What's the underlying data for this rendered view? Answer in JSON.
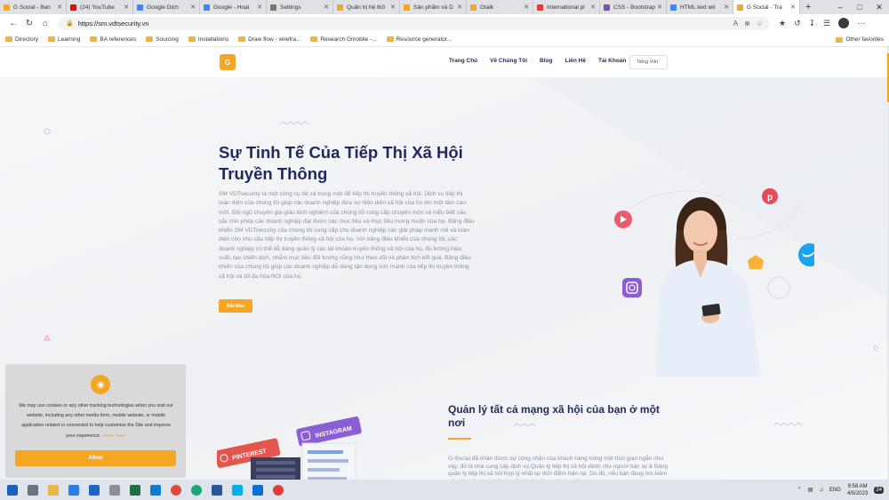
{
  "browser": {
    "tabs": [
      {
        "title": "G Social - Ban",
        "color": "#f5a623"
      },
      {
        "title": "(24) YouTube",
        "color": "#ff0000"
      },
      {
        "title": "Google Dich",
        "color": "#4285f4"
      },
      {
        "title": "Google - Hoạt",
        "color": "#4285f4"
      },
      {
        "title": "Settings",
        "color": "#777777"
      },
      {
        "title": "Quản trị hệ thố",
        "color": "#f5a623"
      },
      {
        "title": "Sản phẩm và D",
        "color": "#f5a623"
      },
      {
        "title": "Gtalk",
        "color": "#f5a623"
      },
      {
        "title": "International pl",
        "color": "#e33b3b"
      },
      {
        "title": "CSS - Bootstrap",
        "color": "#7952b3"
      },
      {
        "title": "HTML text wit",
        "color": "#4285f4"
      },
      {
        "title": "G Social - Tra",
        "color": "#f5a623"
      }
    ],
    "url": "https://sm.vdtsecurity.vn",
    "bookmarks": [
      "Directory",
      "Learning",
      "BA references",
      "Sourcing",
      "Installations",
      "Draw flow - wirefra...",
      "Research Gmobile -...",
      "Resource generator..."
    ],
    "other_favorites": "Other favorites"
  },
  "site": {
    "logo": "G",
    "nav": [
      "Trang Chủ",
      "Về Chúng Tôi",
      "Blog",
      "Liên Hệ",
      "Tài Khoản"
    ],
    "language": "Tiếng Việt"
  },
  "hero": {
    "title": "Sự Tinh Tế Của Tiếp Thị Xã Hội Truyền Thông",
    "body": "SM VDTsecurity là một công cụ tất cả trong một để tiếp thị truyền thông xã hội. Dịch vụ tiếp thị toàn diện của chúng tôi giúp các doanh nghiệp đưa sự hiện diện xã hội của họ lên một tầm cao mới. Đội ngũ chuyên gia giàu kinh nghiệm của chúng tôi cung cấp chuyên môn và hiểu biết sâu sắc cho phép các doanh nghiệp đạt được các mục tiêu và mục tiêu mong muốn của họ. Bảng điều khiển SM VDTsecurity của chúng tôi cung cấp cho doanh nghiệp các giải pháp mạnh mẽ và toàn diện cho nhu cầu tiếp thị truyền thông xã hội của họ. Với bảng điều khiển của chúng tôi, các doanh nghiệp có thể dễ dàng quản lý các tài khoản truyền thông xã hội của họ, đo lường hiệu suất, tạo chiến dịch, nhắm mục tiêu đối tượng cũng như theo dõi và phân tích kết quả. Bảng điều khiển của chúng tôi giúp các doanh nghiệp dễ dàng tận dụng sức mạnh của tiếp thị truyền thông xã hội và tối đa hóa ROI của họ.",
    "cta": "Bắt Đầu"
  },
  "section": {
    "title": "Quản lý tất cả mạng xã hội của bạn ở một nơi",
    "body": "G-Social đã nhận được sự công nhận của khách hàng trong một thời gian ngắn như vậy; đó là nhà cung cấp dịch vụ Quản lý tiếp thị xã hội dành cho người bán lại & Bảng quản lý tiếp thị xã hội hợp lý nhất tại thời điểm hiện tại. Do đó, nếu bạn đang tìm kiếm nền tảng Quản lý tiếp thị xã hội tốt kiếm một cho tiếp thị",
    "card_pinterest": "PINTEREST",
    "card_instagram": "INSTAGRAM"
  },
  "cookie": {
    "text": "We may use cookies or any other tracking technologies when you visit our website, including any other media form, mobile website, or mobile application related or connected to help customize the Site and improve your experience.",
    "learn_more": "Learn more",
    "allow": "Allow"
  },
  "taskbar": {
    "lang": "ENG",
    "time": "9:58 AM",
    "date": "4/5/2023",
    "notif": "24"
  }
}
